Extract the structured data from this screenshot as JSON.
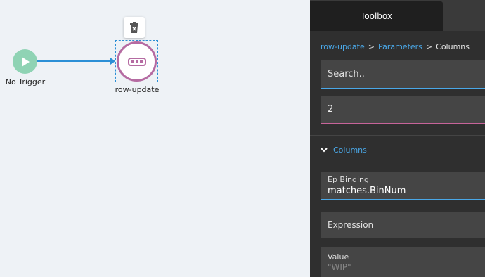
{
  "canvas": {
    "trigger_node": {
      "label": "No Trigger",
      "color": "#8fd3b4",
      "icon": "play-icon"
    },
    "action_node": {
      "label": "row-update",
      "border_color": "#b56ba2",
      "icon": "row-dots-icon"
    },
    "delete_button": {
      "icon": "delete-icon"
    },
    "edge_color": "#2b8fd6"
  },
  "panel": {
    "tab": {
      "label": "Toolbox"
    },
    "breadcrumb": {
      "items": [
        "row-update",
        "Parameters",
        "Columns"
      ],
      "separator": ">"
    },
    "search": {
      "placeholder": "Search.."
    },
    "count": {
      "value": "2"
    },
    "section": {
      "label": "Columns",
      "icon": "chevron-down-icon"
    },
    "ep_binding": {
      "label": "Ep Binding",
      "value": "matches.BinNum"
    },
    "expression": {
      "label": "Expression"
    },
    "value": {
      "label": "Value",
      "value": "\"WIP\""
    }
  },
  "colors": {
    "accent": "#4aa8e8",
    "error_border": "#c7649a",
    "panel_bg": "#2f2f2f"
  }
}
